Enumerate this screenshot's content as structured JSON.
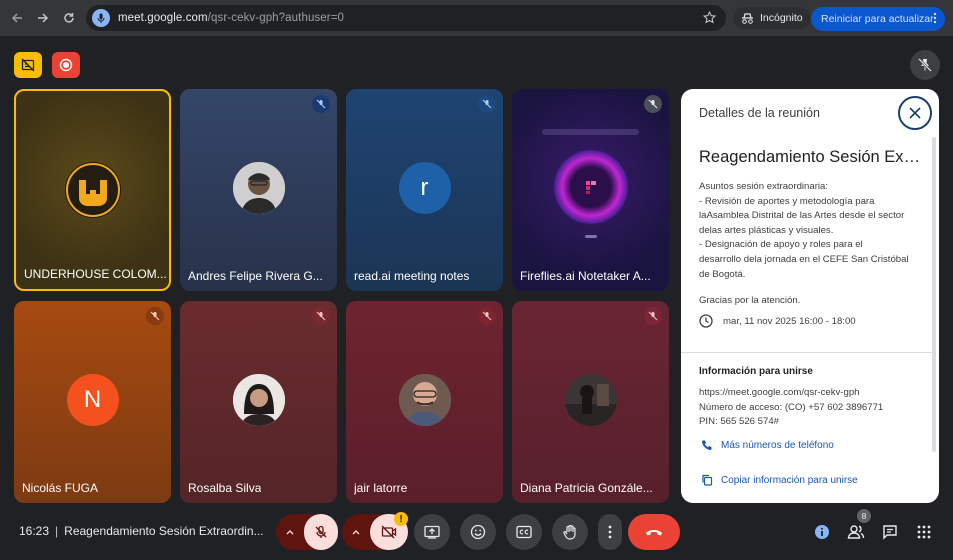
{
  "browser": {
    "url_main": "meet.google.com",
    "url_path": "/qsr-cekv-gph?authuser=0",
    "incognito_label": "Incógnito",
    "update_label": "Reiniciar para actualizar"
  },
  "tiles": [
    {
      "name": "UNDERHOUSE COLOM...",
      "avatar": "logo"
    },
    {
      "name": "Andres Felipe Rivera G...",
      "avatar": "photo"
    },
    {
      "name": "read.ai meeting notes",
      "avatar_letter": "r"
    },
    {
      "name": "Fireflies.ai Notetaker A...",
      "avatar": "fireflies"
    },
    {
      "name": "Nicolás FUGA",
      "avatar_letter": "N"
    },
    {
      "name": "Rosalba Silva",
      "avatar": "photo"
    },
    {
      "name": "jair latorre",
      "avatar": "photo"
    },
    {
      "name": "Diana Patricia Gonzále...",
      "avatar": "photo"
    }
  ],
  "panel": {
    "title": "Detalles de la reunión",
    "meeting_title": "Reagendamiento Sesión Extr...",
    "description": [
      "Asuntos sesión extraordinaria:",
      "- Revisión de aportes y metodología para",
      "laAsamblea Distrital de las Artes desde el sector",
      "delas artes plásticas y visuales.",
      "- Designación de apoyo y roles para el",
      "desarrollo dela jornada en el CEFE San Cristóbal",
      "de Bogotá."
    ],
    "thanks": "Gracias por la atención.",
    "date": "mar, 11 nov 2025  16:00 - 18:00",
    "join_title": "Información para unirse",
    "join_url": "https://meet.google.com/qsr-cekv-gph",
    "access_number": "Número de acceso: (CO) +57 602 3896771",
    "pin": "PIN: 565 526 574#",
    "more_numbers": "Más números de teléfono",
    "copy_info": "Copiar información para unirse"
  },
  "bottom": {
    "time": "16:23",
    "meeting_title": "Reagendamiento Sesión Extraordin...",
    "participants_count": "8",
    "warning_glyph": "!"
  },
  "colors": {
    "speaking_border": "#fbbc04",
    "end_call": "#ea4335",
    "panel_link": "#1a56b7"
  }
}
